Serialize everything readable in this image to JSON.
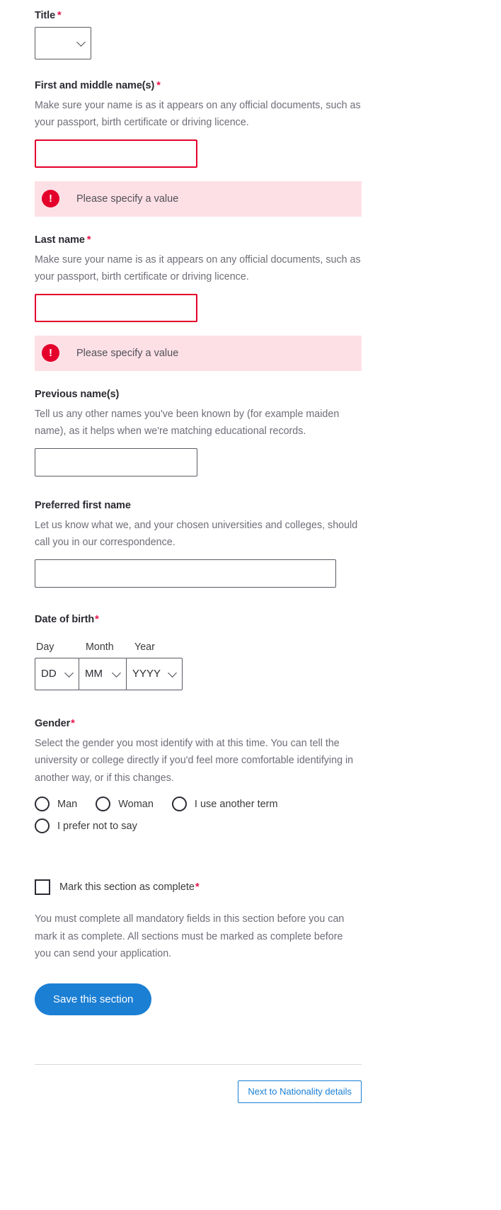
{
  "form": {
    "title_field": {
      "label": "Title",
      "required_mark": "*",
      "value": "",
      "icon": "chevron-down-icon"
    },
    "first_name": {
      "label": "First and middle name(s)",
      "required_mark": "*",
      "hint": "Make sure your name is as it appears on any official documents, such as your passport, birth certificate or driving licence.",
      "value": "",
      "error": "Please specify a value",
      "error_icon": "error-exclamation-icon"
    },
    "last_name": {
      "label": "Last name",
      "required_mark": "*",
      "hint": "Make sure your name is as it appears on any official documents, such as your passport, birth certificate or driving licence.",
      "value": "",
      "error": "Please specify a value",
      "error_icon": "error-exclamation-icon"
    },
    "previous_names": {
      "label": "Previous name(s)",
      "hint": "Tell us any other names you've been known by (for example maiden name), as it helps when we're matching educational records.",
      "value": ""
    },
    "preferred_first_name": {
      "label": "Preferred first name",
      "hint": "Let us know what we, and your chosen universities and colleges, should call you in our correspondence.",
      "value": ""
    },
    "date_of_birth": {
      "label": "Date of birth",
      "required_mark": "*",
      "day": {
        "label": "Day",
        "value": "DD"
      },
      "month": {
        "label": "Month",
        "value": "MM"
      },
      "year": {
        "label": "Year",
        "value": "YYYY"
      }
    },
    "gender": {
      "label": "Gender",
      "required_mark": "*",
      "hint": "Select the gender you most identify with at this time. You can tell the university or college directly if you'd feel more comfortable identifying in another way, or if this changes.",
      "options": [
        {
          "label": "Man",
          "selected": false
        },
        {
          "label": "Woman",
          "selected": false
        },
        {
          "label": "I use another term",
          "selected": false
        },
        {
          "label": "I prefer not to say",
          "selected": false
        }
      ]
    },
    "mark_complete": {
      "label": "Mark this section as complete",
      "required_mark": "*",
      "checked": false,
      "note": "You must complete all mandatory fields in this section before you can mark it as complete. All sections must be marked as complete before you can send your application."
    },
    "save_button": "Save this section",
    "next_button": "Next to Nationality details"
  },
  "colors": {
    "accent_blue": "#1b7fd4",
    "error_red": "#e4002b",
    "error_bg": "#fde0e6",
    "required_star": "#e8134b"
  }
}
